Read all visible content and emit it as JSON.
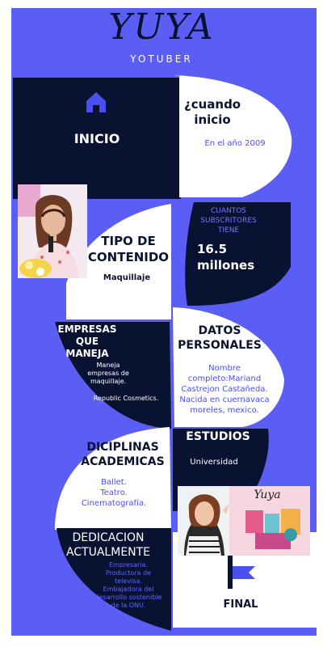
{
  "header": {
    "title": "YUYA",
    "subtitle": "YOTUBER"
  },
  "inicio": {
    "label": "INICIO"
  },
  "cuando": {
    "question": "¿cuando\ninicio",
    "answer": "En el año 2009"
  },
  "subscribers": {
    "label": "CUANTOS\nSUBSCRITORES\nTIENE",
    "value": "16.5\nmillones"
  },
  "contenido": {
    "title": "TIPO DE\nCONTENIDO",
    "value": "Maquillaje"
  },
  "empresas": {
    "title": "EMPRESAS\nQUE\nMANEJA",
    "text1": "Maneja\nempresas de\nmaquillaje.",
    "text2": "Republic Cosmetics."
  },
  "datos": {
    "title": "DATOS\nPERSONALES",
    "text": "Nombre\ncompleto:Mariand\nCastrejon Castañeda.\nNacida en cuernavaca\nmoreles, mexico."
  },
  "diciplinas": {
    "title": "DICIPLINAS\nACADEMICAS",
    "text": "Ballet.\nTeatro.\nCinematografía."
  },
  "estudios": {
    "title": "ESTUDIOS",
    "text": "Universidad"
  },
  "dedicacion": {
    "title": "DEDICACION\nACTUALMENTE",
    "text": "Empresaria.\nProductora de\ntelevisa.\nEmbajadora del\ndesarrollo sostenible\nde la ONU."
  },
  "final": {
    "label": "FINAL",
    "photo_logo": "Yuya"
  },
  "colors": {
    "background": "#5b5ef4",
    "navy": "#0a1232",
    "accent_blue": "#4a4ff0",
    "white": "#ffffff"
  },
  "icons": [
    "home-icon",
    "flag-icon"
  ]
}
